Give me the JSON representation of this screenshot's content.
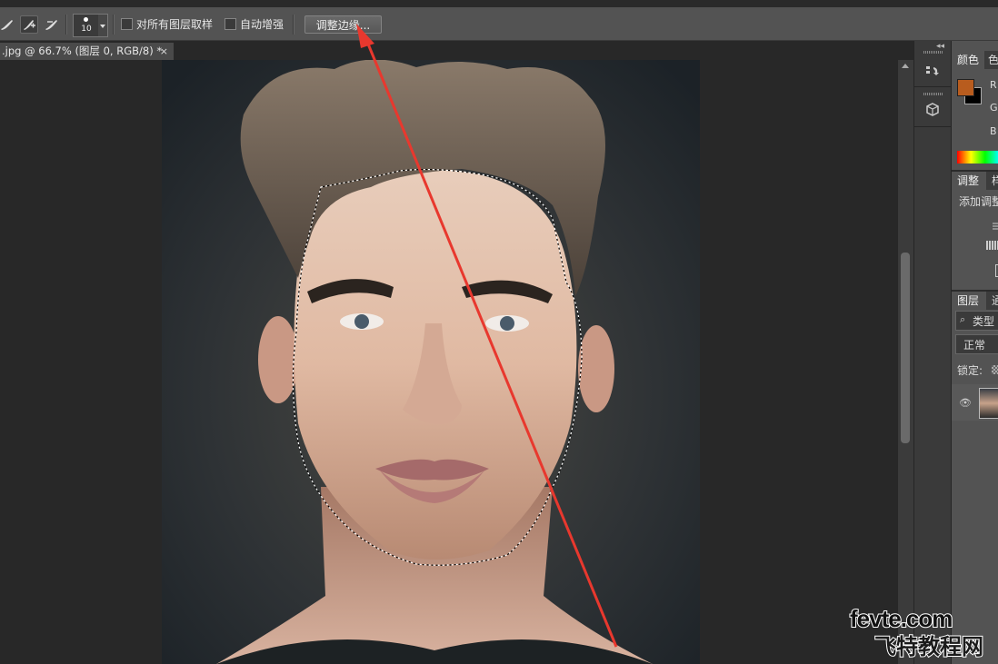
{
  "options_bar": {
    "brush_size": "10",
    "sample_all_layers_label": "对所有图层取样",
    "auto_enhance_label": "自动增强",
    "refine_edge_label": "调整边缘..."
  },
  "document_tab": {
    "title": ".jpg @ 66.7% (图层 0, RGB/8) *",
    "close": "×"
  },
  "panels": {
    "color_tab": "颜色",
    "color_tab2": "色",
    "channel_r": "R",
    "channel_g": "G",
    "channel_b": "B",
    "adjust_tab": "调整",
    "adjust_tab2": "样",
    "add_adjustment": "添加调整",
    "layers_tab": "图层",
    "layers_tab2": "通",
    "kind_filter": "类型",
    "blend_mode": "正常",
    "lock_label": "锁定:",
    "foreground_color": "#b85c1e",
    "background_color": "#000000"
  },
  "watermark": {
    "line1": "fevte.com",
    "line2": "飞特教程网"
  },
  "annotation": {
    "arrow_color": "#e8382e"
  }
}
